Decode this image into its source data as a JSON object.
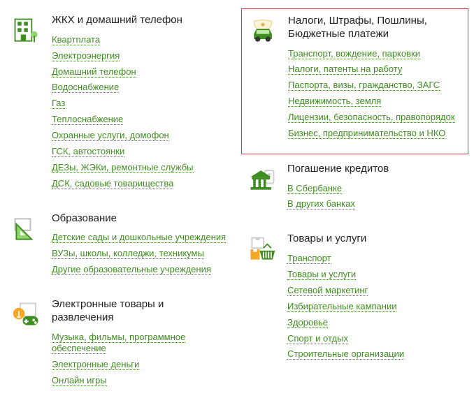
{
  "categories": {
    "utilities": {
      "title": "ЖКХ и домашний телефон",
      "links": [
        "Квартплата",
        "Электроэнергия",
        "Домашний телефон",
        "Водоснабжение",
        "Газ",
        "Теплоснабжение",
        "Охранные услуги, домофон",
        "ГСК, автостоянки",
        "ДЕЗы, ЖЭКи, ремонтные службы",
        "ДСК, садовые товарищества"
      ]
    },
    "education": {
      "title": "Образование",
      "links": [
        "Детские сады и дошкольные учреждения",
        "ВУЗы, школы, колледжи, техникумы",
        "Другие образовательные учреждения"
      ]
    },
    "entertainment": {
      "title": "Электронные товары и развлечения",
      "links": [
        "Музыка, фильмы, программное обеспечение",
        "Электронные деньги",
        "Онлайн игры"
      ]
    },
    "taxes": {
      "title": "Налоги, Штрафы, Пошлины, Бюджетные платежи",
      "links": [
        "Транспорт, вождение, парковки",
        "Налоги, патенты на работу",
        "Паспорта, визы, гражданство, ЗАГС",
        "Недвижимость, земля",
        "Лицензии, безопасность, правопорядок",
        "Бизнес, предпринимательство и НКО"
      ]
    },
    "loans": {
      "title": "Погашение кредитов",
      "links": [
        "В Сбербанке",
        "В других банках"
      ]
    },
    "goods": {
      "title": "Товары и услуги",
      "links": [
        "Транспорт",
        "Товары и услуги",
        "Сетевой маркетинг",
        "Избирательные кампании",
        "Здоровье",
        "Спорт и отдых",
        "Строительные организации"
      ]
    }
  }
}
